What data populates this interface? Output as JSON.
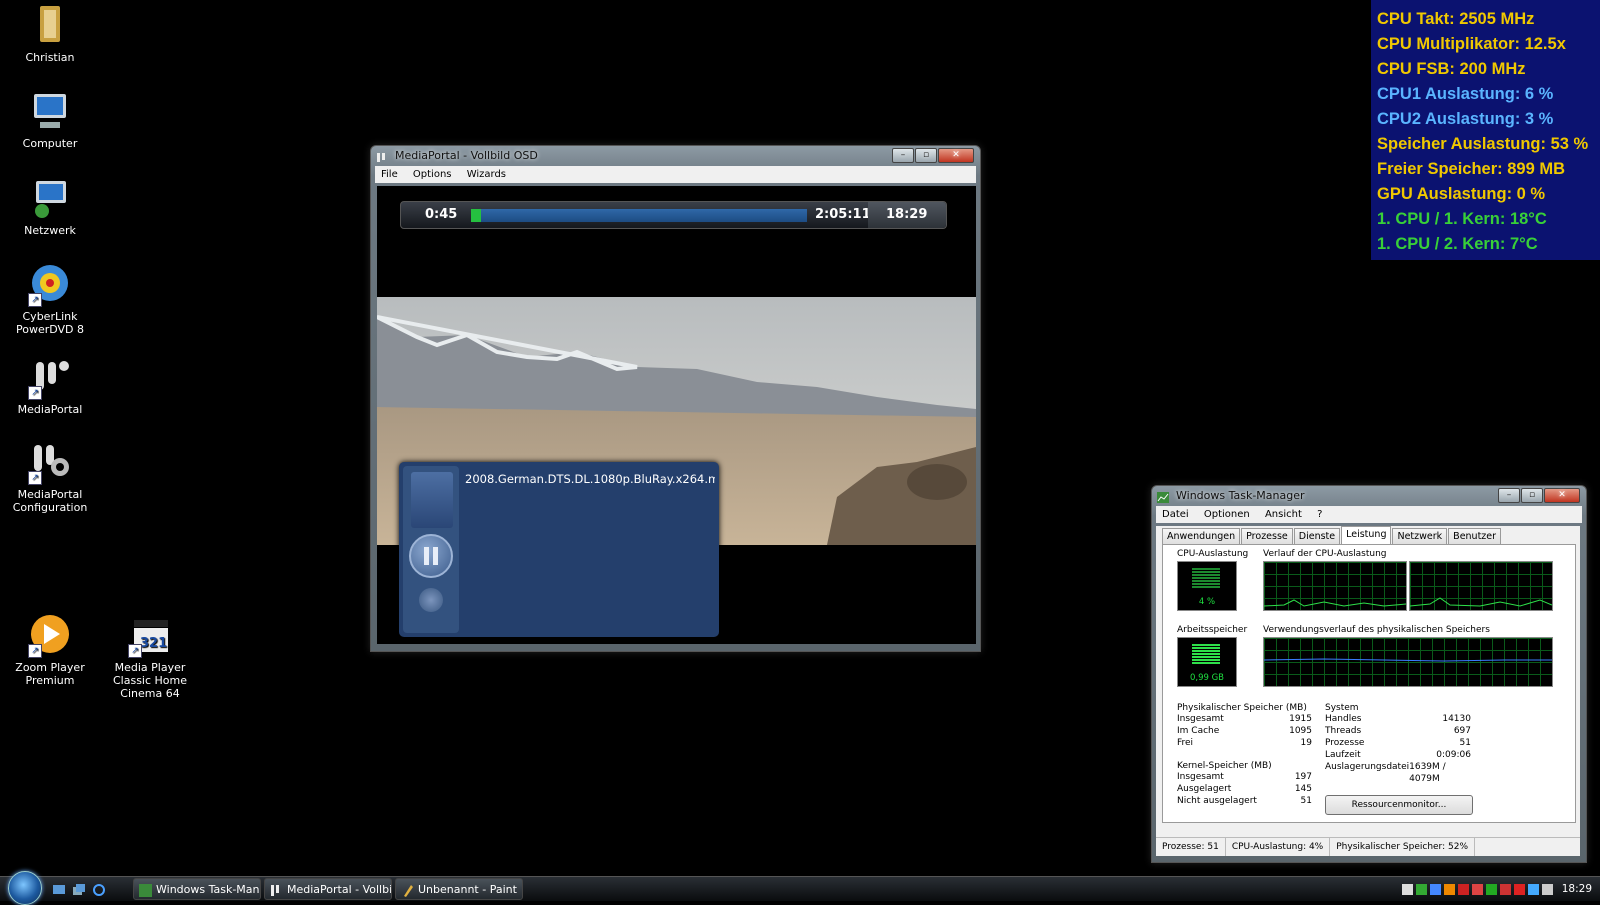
{
  "desktop": {
    "icons": [
      {
        "label": "Christian"
      },
      {
        "label": "Computer"
      },
      {
        "label": "Netzwerk"
      },
      {
        "label": "CyberLink PowerDVD 8"
      },
      {
        "label": "MediaPortal"
      },
      {
        "label": "MediaPortal Configuration"
      },
      {
        "label": "Zoom Player Premium"
      },
      {
        "label": "Media Player Classic Home Cinema 64"
      }
    ]
  },
  "overlay": {
    "lines": [
      {
        "text": "CPU Takt: 2505 MHz",
        "color": "#f0c800"
      },
      {
        "text": "CPU Multiplikator: 12.5x",
        "color": "#f0c800"
      },
      {
        "text": "CPU FSB: 200 MHz",
        "color": "#f0c800"
      },
      {
        "text": "CPU1 Auslastung: 6 %",
        "color": "#5ab4ff"
      },
      {
        "text": "CPU2 Auslastung: 3 %",
        "color": "#5ab4ff"
      },
      {
        "text": "Speicher Auslastung: 53 %",
        "color": "#f0c800"
      },
      {
        "text": "Freier Speicher: 899 MB",
        "color": "#f0c800"
      },
      {
        "text": "GPU Auslastung: 0 %",
        "color": "#f0c800"
      },
      {
        "text": "1. CPU / 1. Kern: 18°C",
        "color": "#38d038"
      },
      {
        "text": "1. CPU / 2. Kern: 7°C",
        "color": "#38d038"
      }
    ]
  },
  "mediaportal": {
    "title": "MediaPortal - Vollbild OSD",
    "menu": [
      "File",
      "Options",
      "Wizards"
    ],
    "osd": {
      "elapsed": "0:45",
      "duration": "2:05:11",
      "clock": "18:29",
      "progress": 0.006,
      "filename": "2008.German.DTS.DL.1080p.BluRay.x264.m"
    }
  },
  "taskmanager": {
    "title": "Windows Task-Manager",
    "menu": [
      "Datei",
      "Optionen",
      "Ansicht",
      "?"
    ],
    "tabs": [
      "Anwendungen",
      "Prozesse",
      "Dienste",
      "Leistung",
      "Netzwerk",
      "Benutzer"
    ],
    "active_tab": "Leistung",
    "cpu_label": "CPU-Auslastung",
    "cpu_history_label": "Verlauf der CPU-Auslastung",
    "cpu_value": "4 %",
    "mem_label": "Arbeitsspeicher",
    "mem_history_label": "Verwendungsverlauf des physikalischen Speichers",
    "mem_value": "0,99 GB",
    "phys": {
      "header": "Physikalischer Speicher (MB)",
      "rows": [
        {
          "k": "Insgesamt",
          "v": "1915"
        },
        {
          "k": "Im Cache",
          "v": "1095"
        },
        {
          "k": "Frei",
          "v": "19"
        }
      ]
    },
    "kernel": {
      "header": "Kernel-Speicher (MB)",
      "rows": [
        {
          "k": "Insgesamt",
          "v": "197"
        },
        {
          "k": "Ausgelagert",
          "v": "145"
        },
        {
          "k": "Nicht ausgelagert",
          "v": "51"
        }
      ]
    },
    "system": {
      "header": "System",
      "rows": [
        {
          "k": "Handles",
          "v": "14130"
        },
        {
          "k": "Threads",
          "v": "697"
        },
        {
          "k": "Prozesse",
          "v": "51"
        },
        {
          "k": "Laufzeit",
          "v": "0:09:06"
        },
        {
          "k": "Auslagerungsdatei",
          "v": "1639M / 4079M"
        }
      ]
    },
    "resource_button": "Ressourcenmonitor...",
    "status": {
      "processes": "Prozesse: 51",
      "cpu": "CPU-Auslastung: 4%",
      "mem": "Physikalischer Speicher: 52%"
    }
  },
  "taskbar": {
    "tasks": [
      {
        "label": "Windows Task-Man..."
      },
      {
        "label": "MediaPortal - Vollbi..."
      },
      {
        "label": "Unbenannt - Paint"
      }
    ],
    "clock": "18:29"
  }
}
